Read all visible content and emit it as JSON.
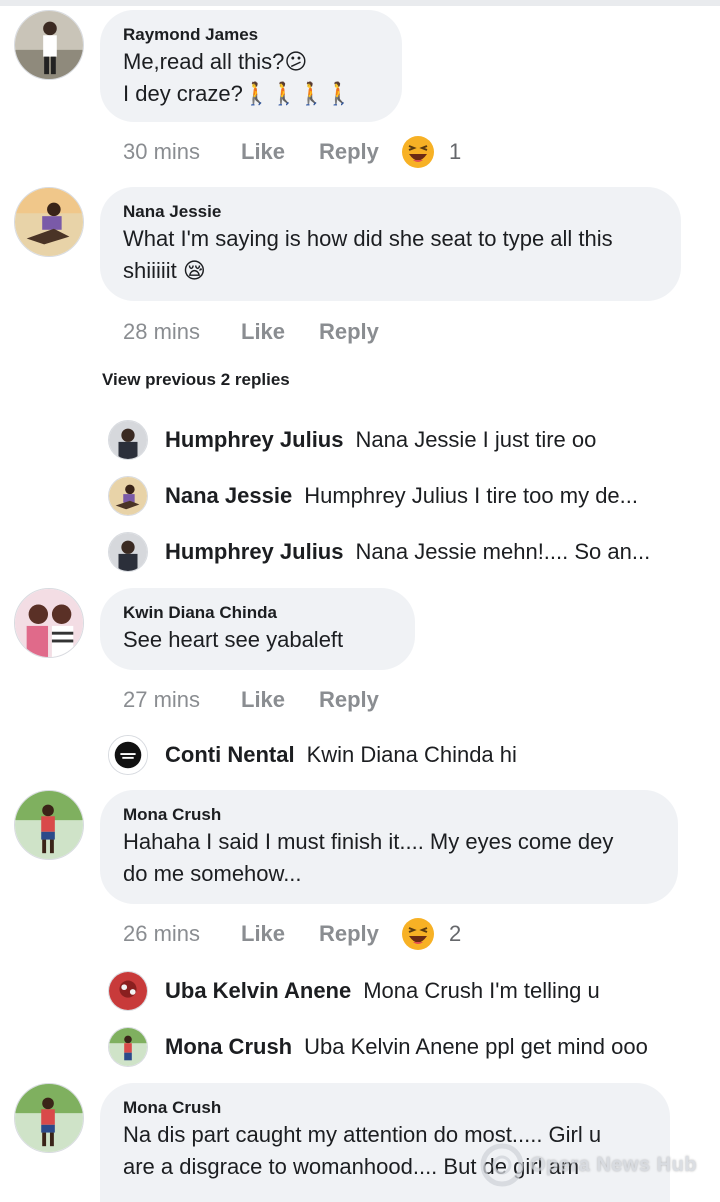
{
  "comments": [
    {
      "author": "Raymond James",
      "lines": [
        "Me,read all this?😕",
        "I dey craze?🚶🚶🚶🚶"
      ],
      "time": "30 mins",
      "like": "Like",
      "reply": "Reply",
      "reaction_count": "1"
    },
    {
      "author": "Nana Jessie",
      "lines": [
        "What I'm saying is how did she seat to type all this",
        "shiiiiit 😪"
      ],
      "time": "28 mins",
      "like": "Like",
      "reply": "Reply"
    },
    {
      "author": "Kwin Diana Chinda",
      "lines": [
        "See heart see yabaleft"
      ],
      "time": "27 mins",
      "like": "Like",
      "reply": "Reply"
    },
    {
      "author": "Mona Crush",
      "lines": [
        "Hahaha I said I must finish it.... My eyes come dey",
        "do me somehow..."
      ],
      "time": "26 mins",
      "like": "Like",
      "reply": "Reply",
      "reaction_count": "2"
    },
    {
      "author": "Mona Crush",
      "lines": [
        "Na dis part caught my attention do most..... Girl u",
        "are a disgrace to womanhood.... But de girl am"
      ]
    }
  ],
  "view_previous": "View previous 2 replies",
  "replies_nana": [
    {
      "name": "Humphrey Julius",
      "text": "Nana Jessie I just tire oo"
    },
    {
      "name": "Nana Jessie",
      "text": "Humphrey Julius I tire too my de..."
    },
    {
      "name": "Humphrey Julius",
      "text": "Nana Jessie mehn!.... So an..."
    }
  ],
  "replies_kwin": [
    {
      "name": "Conti Nental",
      "text": "Kwin Diana Chinda hi"
    }
  ],
  "replies_mona": [
    {
      "name": "Uba Kelvin Anene",
      "text": "Mona Crush I'm telling u"
    },
    {
      "name": "Mona Crush",
      "text": "Uba Kelvin Anene ppl get mind ooo"
    }
  ],
  "watermark": "Opera News Hub",
  "colors": {
    "bubble": "#f0f2f5",
    "meta_text": "#8a8d91",
    "haha_yellow": "#f7b125"
  }
}
